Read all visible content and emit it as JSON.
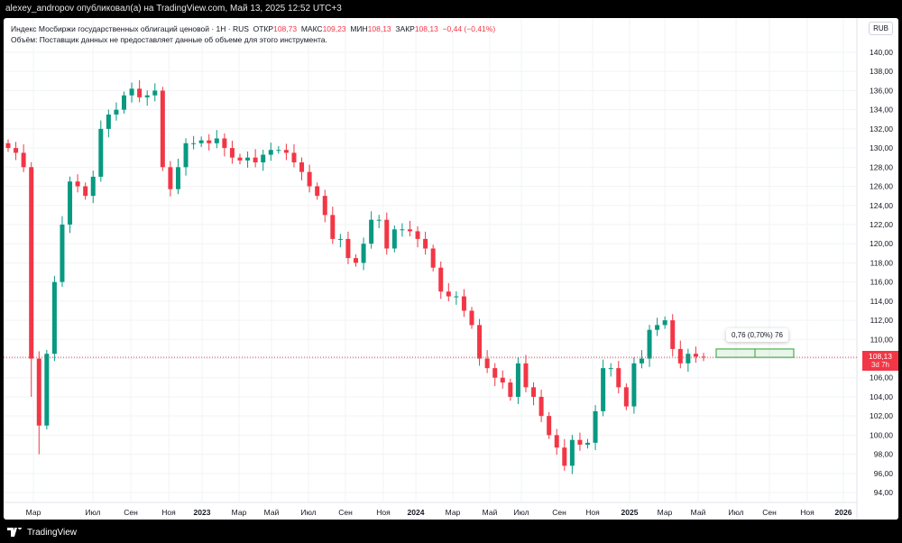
{
  "header": {
    "text": "alexey_andropov опубликовал(а) на TradingView.com, Май 13, 2025 12:52 UTC+3"
  },
  "legend": {
    "symbol": "Индекс Мосбиржи государственных облигаций ценовой · 1H · RUS",
    "open_label": "ОТКР",
    "open": "108,73",
    "high_label": "МАКС",
    "high": "109,23",
    "low_label": "МИН",
    "low": "108,13",
    "close_label": "ЗАКР",
    "close": "108,13",
    "change": "−0,44 (−0,41%)",
    "volume_note": "Объём: Поставщик данных не предоставляет данные об объеме для этого инструмента."
  },
  "currency": "RUB",
  "price_tag": {
    "price": "108,13",
    "countdown": "3d 7h"
  },
  "measure": {
    "label": "0,76 (0,70%) 76"
  },
  "footer": {
    "brand": "TradingView"
  },
  "colors": {
    "up": "#089981",
    "down": "#f23645",
    "measure": "#4caf50"
  },
  "chart_data": {
    "type": "candlestick",
    "ylim": [
      93,
      142
    ],
    "y_ticks": [
      "94,00",
      "96,00",
      "98,00",
      "100,00",
      "102,00",
      "104,00",
      "106,00",
      "108,00",
      "110,00",
      "112,00",
      "114,00",
      "116,00",
      "118,00",
      "120,00",
      "122,00",
      "124,00",
      "126,00",
      "128,00",
      "130,00",
      "132,00",
      "134,00",
      "136,00",
      "138,00",
      "140,00"
    ],
    "x_ticks": [
      "Мар",
      "Июл",
      "Сен",
      "Ноя",
      "2023",
      "Мар",
      "Май",
      "Июл",
      "Сен",
      "Ноя",
      "2024",
      "Мар",
      "Май",
      "Июл",
      "Сен",
      "Ноя",
      "2025",
      "Мар",
      "Май",
      "Июл",
      "Сен",
      "Ноя",
      "2026"
    ],
    "first_open": 130.5,
    "closes": [
      130,
      129.5,
      128,
      108,
      101,
      108.5,
      116,
      122,
      126.5,
      126,
      125,
      127,
      132,
      133.5,
      134,
      135.5,
      136.2,
      135.3,
      135.5,
      136,
      128,
      125.7,
      128,
      130.5,
      130.5,
      130.8,
      130.5,
      131,
      130,
      129,
      128.7,
      129,
      128.5,
      129.3,
      129.8,
      129.8,
      129.5,
      128.5,
      127.5,
      126,
      125,
      123,
      120.5,
      120.5,
      118.5,
      118,
      120,
      122.5,
      122.5,
      119.5,
      121.5,
      121.5,
      121.3,
      120.5,
      119.5,
      117.5,
      115,
      114.5,
      114.5,
      113,
      111.5,
      108,
      107,
      106,
      105.5,
      104,
      107.5,
      105,
      104,
      102,
      100,
      98.7,
      96.8,
      99.5,
      99,
      99.2,
      102.5,
      107,
      107,
      105,
      103,
      107.5,
      108,
      111,
      111.5,
      112,
      109,
      107.5,
      108.5,
      108.2,
      108.13
    ],
    "lows_override": {
      "3": 104,
      "4": 98
    },
    "last_price": 108.13,
    "measure_range": [
      108.13,
      109.0
    ]
  }
}
